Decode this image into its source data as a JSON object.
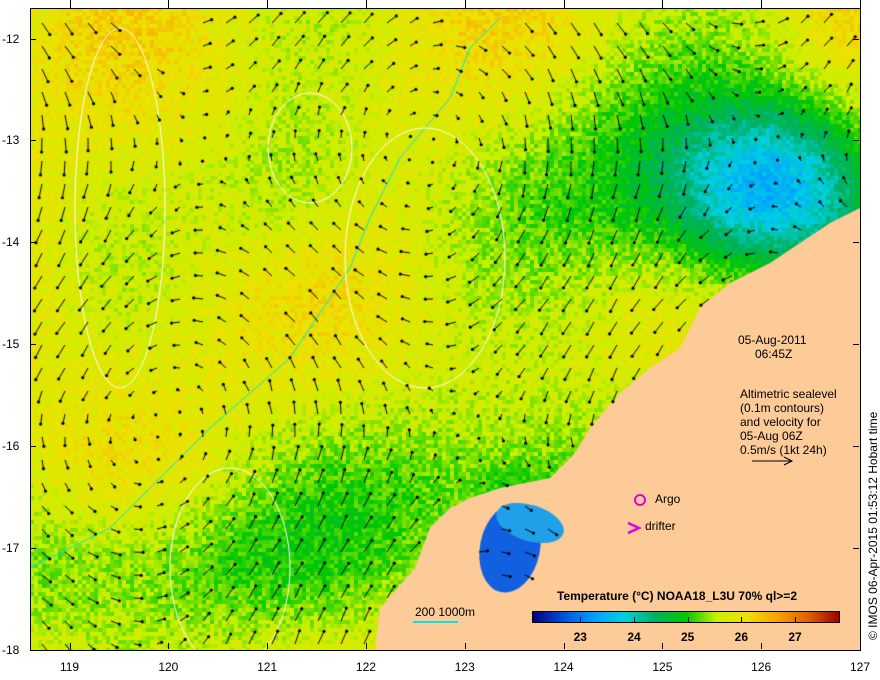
{
  "map": {
    "lon_range": [
      118.6,
      127
    ],
    "lat_range": [
      -18,
      -11.7
    ],
    "lon_ticks": [
      "119",
      "120",
      "121",
      "122",
      "123",
      "124",
      "125",
      "126",
      "127"
    ],
    "lat_ticks": [
      "-12",
      "-13",
      "-14",
      "-15",
      "-16",
      "-17",
      "-18"
    ],
    "land_color": "#FDCB98",
    "contour_color": "#FFFFFF",
    "bathymetry_color": "#00E5E5",
    "vector_color": "#000000"
  },
  "annotations": {
    "date": "05-Aug-2011",
    "time": "06:45Z",
    "altimetry_lines": [
      "Altimetric sealevel",
      "(0.1m contours)",
      "and velocity for",
      "05-Aug 06Z",
      "0.5m/s (1kt 24h)"
    ],
    "argo_label": "Argo",
    "drifter_label": "drifter",
    "marker_color": "#E000E0",
    "bathymetry_legend": "200  1000m"
  },
  "colorbar": {
    "title": "Temperature (°C) NOAA18_L3U 70% ql>=2",
    "ticks": [
      "23",
      "24",
      "25",
      "26",
      "27"
    ],
    "range": [
      22.1,
      27.8
    ],
    "colors": [
      "#000080",
      "#0050E0",
      "#00A0FF",
      "#00D0E0",
      "#00B060",
      "#00C800",
      "#C8F000",
      "#F0E000",
      "#F8A000",
      "#E06000",
      "#A00000"
    ]
  },
  "credit": "© IMOS 06-Apr-2015 01:53:12 Hobart time"
}
